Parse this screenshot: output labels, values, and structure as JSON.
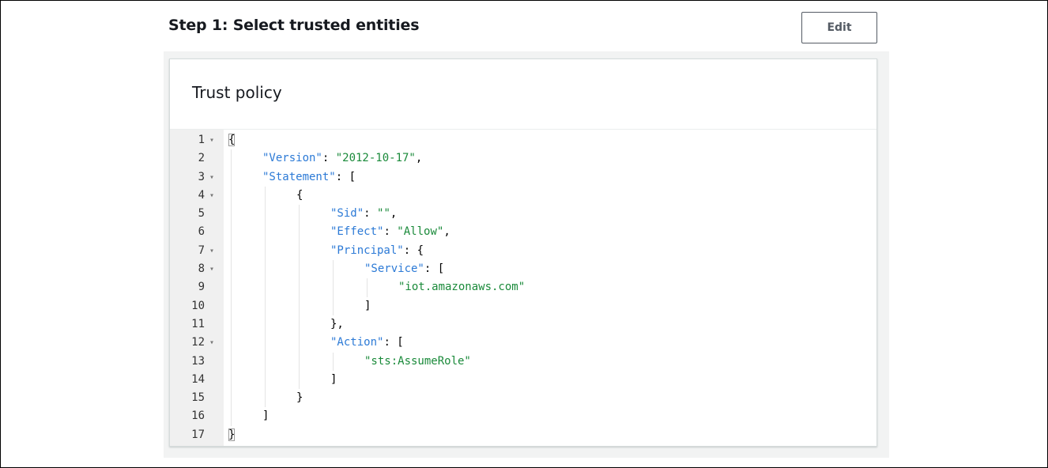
{
  "section": {
    "title": "Step 1: Select trusted entities",
    "edit_label": "Edit"
  },
  "card": {
    "title": "Trust policy"
  },
  "editor": {
    "lines": [
      {
        "n": "1",
        "fold": true,
        "indent": 0,
        "parts": [
          {
            "t": "{",
            "c": "punct",
            "box": true
          }
        ]
      },
      {
        "n": "2",
        "fold": false,
        "indent": 1,
        "parts": [
          {
            "t": "\"Version\"",
            "c": "key"
          },
          {
            "t": ": ",
            "c": "punct"
          },
          {
            "t": "\"2012-10-17\"",
            "c": "str"
          },
          {
            "t": ",",
            "c": "punct"
          }
        ]
      },
      {
        "n": "3",
        "fold": true,
        "indent": 1,
        "parts": [
          {
            "t": "\"Statement\"",
            "c": "key"
          },
          {
            "t": ": [",
            "c": "punct"
          }
        ]
      },
      {
        "n": "4",
        "fold": true,
        "indent": 2,
        "parts": [
          {
            "t": "{",
            "c": "punct"
          }
        ]
      },
      {
        "n": "5",
        "fold": false,
        "indent": 3,
        "parts": [
          {
            "t": "\"Sid\"",
            "c": "key"
          },
          {
            "t": ": ",
            "c": "punct"
          },
          {
            "t": "\"\"",
            "c": "str"
          },
          {
            "t": ",",
            "c": "punct"
          }
        ]
      },
      {
        "n": "6",
        "fold": false,
        "indent": 3,
        "parts": [
          {
            "t": "\"Effect\"",
            "c": "key"
          },
          {
            "t": ": ",
            "c": "punct"
          },
          {
            "t": "\"Allow\"",
            "c": "str"
          },
          {
            "t": ",",
            "c": "punct"
          }
        ]
      },
      {
        "n": "7",
        "fold": true,
        "indent": 3,
        "parts": [
          {
            "t": "\"Principal\"",
            "c": "key"
          },
          {
            "t": ": {",
            "c": "punct"
          }
        ]
      },
      {
        "n": "8",
        "fold": true,
        "indent": 4,
        "parts": [
          {
            "t": "\"Service\"",
            "c": "key"
          },
          {
            "t": ": [",
            "c": "punct"
          }
        ]
      },
      {
        "n": "9",
        "fold": false,
        "indent": 5,
        "parts": [
          {
            "t": "\"iot.amazonaws.com\"",
            "c": "str"
          }
        ]
      },
      {
        "n": "10",
        "fold": false,
        "indent": 4,
        "parts": [
          {
            "t": "]",
            "c": "punct"
          }
        ]
      },
      {
        "n": "11",
        "fold": false,
        "indent": 3,
        "parts": [
          {
            "t": "},",
            "c": "punct"
          }
        ]
      },
      {
        "n": "12",
        "fold": true,
        "indent": 3,
        "parts": [
          {
            "t": "\"Action\"",
            "c": "key"
          },
          {
            "t": ": [",
            "c": "punct"
          }
        ]
      },
      {
        "n": "13",
        "fold": false,
        "indent": 4,
        "parts": [
          {
            "t": "\"sts:AssumeRole\"",
            "c": "str"
          }
        ]
      },
      {
        "n": "14",
        "fold": false,
        "indent": 3,
        "parts": [
          {
            "t": "]",
            "c": "punct"
          }
        ]
      },
      {
        "n": "15",
        "fold": false,
        "indent": 2,
        "parts": [
          {
            "t": "}",
            "c": "punct"
          }
        ]
      },
      {
        "n": "16",
        "fold": false,
        "indent": 1,
        "parts": [
          {
            "t": "]",
            "c": "punct"
          }
        ]
      },
      {
        "n": "17",
        "fold": false,
        "indent": 0,
        "parts": [
          {
            "t": "}",
            "c": "punct",
            "box": true
          }
        ]
      }
    ],
    "fold_icon": "caret-down-icon"
  },
  "colors": {
    "key": "#2c7ad6",
    "string": "#1a8a3a",
    "gutter": "#f0f0f0",
    "panel": "#f2f3f3"
  }
}
